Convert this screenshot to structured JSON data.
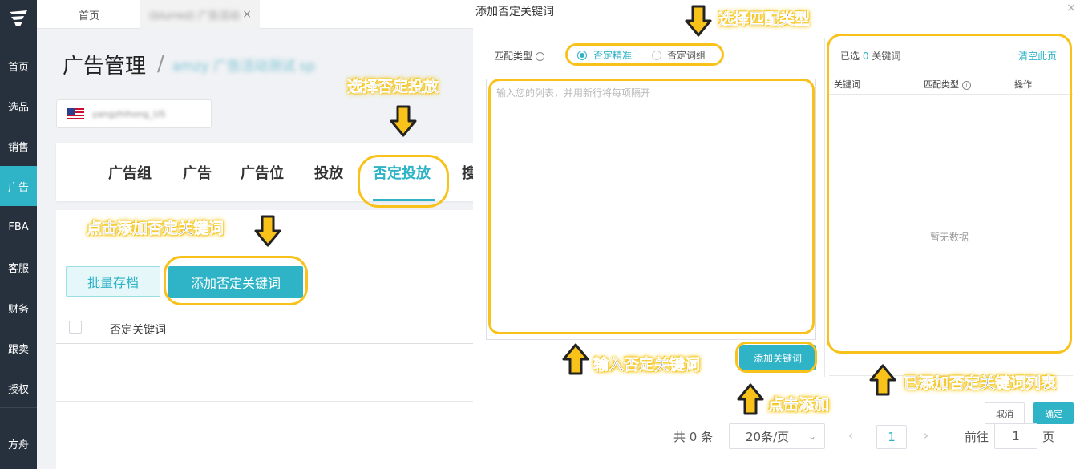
{
  "sidebar": {
    "items": [
      {
        "label": "首页"
      },
      {
        "label": "选品"
      },
      {
        "label": "销售"
      },
      {
        "label": "广告",
        "active": true
      },
      {
        "label": "FBA"
      },
      {
        "label": "客服"
      },
      {
        "label": "财务"
      },
      {
        "label": "跟卖"
      },
      {
        "label": "授权"
      },
      {
        "label": "方舟"
      }
    ]
  },
  "tabs": [
    {
      "label": "首页"
    },
    {
      "label": "(blurred) 广告活动"
    }
  ],
  "page": {
    "title": "广告管理",
    "separator": "/",
    "breadcrumb_blurred": "amzy 广告活动测试 sp",
    "account_blurred": "yangzhihong_US"
  },
  "subnav": {
    "items": [
      "广告组",
      "广告",
      "广告位",
      "投放",
      "否定投放",
      "搜"
    ],
    "active": "否定投放"
  },
  "actions": {
    "batch_archive": "批量存档",
    "add_negative_keyword": "添加否定关键词"
  },
  "table": {
    "columns": [
      "否定关键词"
    ]
  },
  "dialog": {
    "title": "添加否定关键词",
    "close": "×",
    "match_type_label": "匹配类型",
    "match_options": [
      {
        "label": "否定精准",
        "selected": true
      },
      {
        "label": "否定词组",
        "selected": false
      }
    ],
    "textarea_placeholder": "输入您的列表，并用新行将每项隔开",
    "add_button": "添加关键词",
    "selected_prefix": "已选",
    "selected_count": "0",
    "selected_suffix": "关键词",
    "clear_page": "清空此页",
    "right_columns": [
      "关键词",
      "匹配类型",
      "操作"
    ],
    "empty_text": "暂无数据",
    "cancel": "取消",
    "confirm": "确定"
  },
  "pagination": {
    "total": "共 0 条",
    "page_size": "20条/页",
    "current_page": "1",
    "goto_label": "前往",
    "goto_value": "1",
    "page_suffix": "页"
  },
  "annotations": {
    "select_negative_targeting": "选择否定投放",
    "click_add_negative_keyword": "点击添加否定关键词",
    "select_match_type": "选择匹配类型",
    "enter_negative_keyword": "输入否定关键词",
    "click_add": "点击添加",
    "added_list": "已添加否定关键词列表"
  },
  "colors": {
    "sidebar": "#26313d",
    "accent": "#2eb3c7",
    "highlight": "#f8c21a"
  }
}
